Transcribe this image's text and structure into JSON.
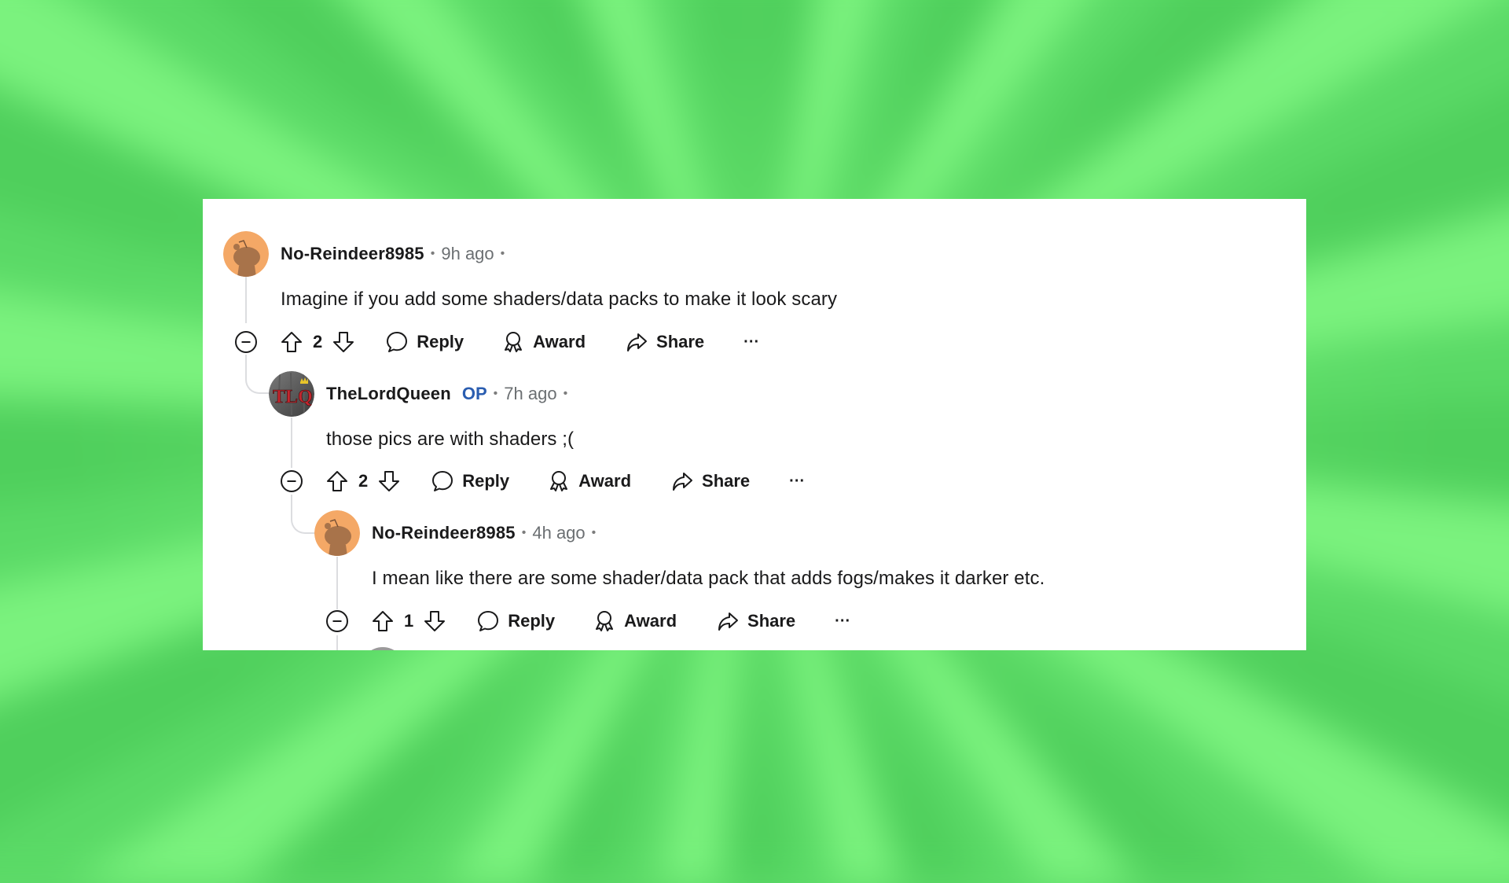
{
  "page": {
    "background_color": "#5fdc6a",
    "card_background": "#ffffff"
  },
  "colors": {
    "op_badge": "#2a5db0",
    "text": "#1a1a1b",
    "meta": "#6b6f72",
    "thread_line": "#dcdde0",
    "snoo_avatar_bg": "#f4a866"
  },
  "comments": [
    {
      "username": "No-Reindeer8985",
      "is_op": false,
      "op_label": "",
      "separator": "•",
      "time": "9h ago",
      "trailing_dot": "•",
      "avatar": "snoo-avatar-icon",
      "body": "Imagine if you add some shaders/data packs to make it look scary",
      "score": "2",
      "actions": {
        "collapse_icon": "minus-circle-icon",
        "upvote_icon": "arrow-up-icon",
        "downvote_icon": "arrow-down-icon",
        "reply_label": "Reply",
        "reply_icon": "speech-bubble-icon",
        "award_label": "Award",
        "award_icon": "ribbon-icon",
        "share_label": "Share",
        "share_icon": "share-arrow-icon",
        "more_label": "···"
      }
    },
    {
      "username": "TheLordQueen",
      "is_op": true,
      "op_label": "OP",
      "separator": "•",
      "time": "7h ago",
      "trailing_dot": "•",
      "avatar": "tlq-avatar-icon",
      "body": "those pics are with shaders ;(",
      "score": "2",
      "actions": {
        "collapse_icon": "minus-circle-icon",
        "upvote_icon": "arrow-up-icon",
        "downvote_icon": "arrow-down-icon",
        "reply_label": "Reply",
        "reply_icon": "speech-bubble-icon",
        "award_label": "Award",
        "award_icon": "ribbon-icon",
        "share_label": "Share",
        "share_icon": "share-arrow-icon",
        "more_label": "···"
      }
    },
    {
      "username": "No-Reindeer8985",
      "is_op": false,
      "op_label": "",
      "separator": "•",
      "time": "4h ago",
      "trailing_dot": "•",
      "avatar": "snoo-avatar-icon",
      "body": "I mean like there are some shader/data pack that adds fogs/makes it darker etc.",
      "score": "1",
      "actions": {
        "collapse_icon": "minus-circle-icon",
        "upvote_icon": "arrow-up-icon",
        "downvote_icon": "arrow-down-icon",
        "reply_label": "Reply",
        "reply_icon": "speech-bubble-icon",
        "award_label": "Award",
        "award_icon": "ribbon-icon",
        "share_label": "Share",
        "share_icon": "share-arrow-icon",
        "more_label": "···"
      }
    }
  ]
}
